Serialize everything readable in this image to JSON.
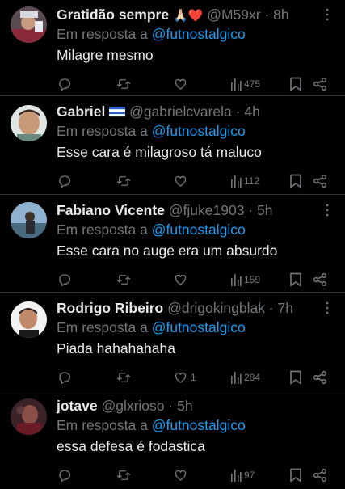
{
  "colors": {
    "background": "#000000",
    "text": "#e7e9ea",
    "muted": "#71767b",
    "accent": "#1d9bf0",
    "divider": "#2f3336"
  },
  "tweets": [
    {
      "name": "Gratidão sempre",
      "name_emoji": "🙏🏻❤️",
      "handle": "@M59xr",
      "time": "8h",
      "reply_prefix": "Em resposta a",
      "reply_to": "@futnostalgico",
      "text": "Milagre mesmo",
      "views": "475",
      "likes": ""
    },
    {
      "name": "Gabriel",
      "name_emoji": "flag",
      "handle": "@gabrielcvarela",
      "time": "4h",
      "reply_prefix": "Em resposta a",
      "reply_to": "@futnostalgico",
      "text": "Esse cara é milagroso tá maluco",
      "views": "112",
      "likes": ""
    },
    {
      "name": "Fabiano Vicente",
      "handle": "@fjuke1903",
      "time": "5h",
      "reply_prefix": "Em resposta a",
      "reply_to": "@futnostalgico",
      "text": "Esse cara no auge era um absurdo",
      "views": "159",
      "likes": ""
    },
    {
      "name": "Rodrigo Ribeiro",
      "handle": "@drigokingblak",
      "time": "7h",
      "reply_prefix": "Em resposta a",
      "reply_to": "@futnostalgico",
      "text": "Piada hahahahaha",
      "views": "284",
      "likes": "1"
    },
    {
      "name": "jotave",
      "handle": "@glxrioso",
      "time": "5h",
      "reply_prefix": "Em resposta a",
      "reply_to": "@futnostalgico",
      "text": "essa defesa é fodastica",
      "views": "97",
      "likes": ""
    }
  ],
  "icons": {
    "reply": "reply-icon",
    "retweet": "retweet-icon",
    "like": "heart-icon",
    "views": "views-icon",
    "bookmark": "bookmark-icon",
    "share": "share-icon",
    "more": "more-icon"
  }
}
